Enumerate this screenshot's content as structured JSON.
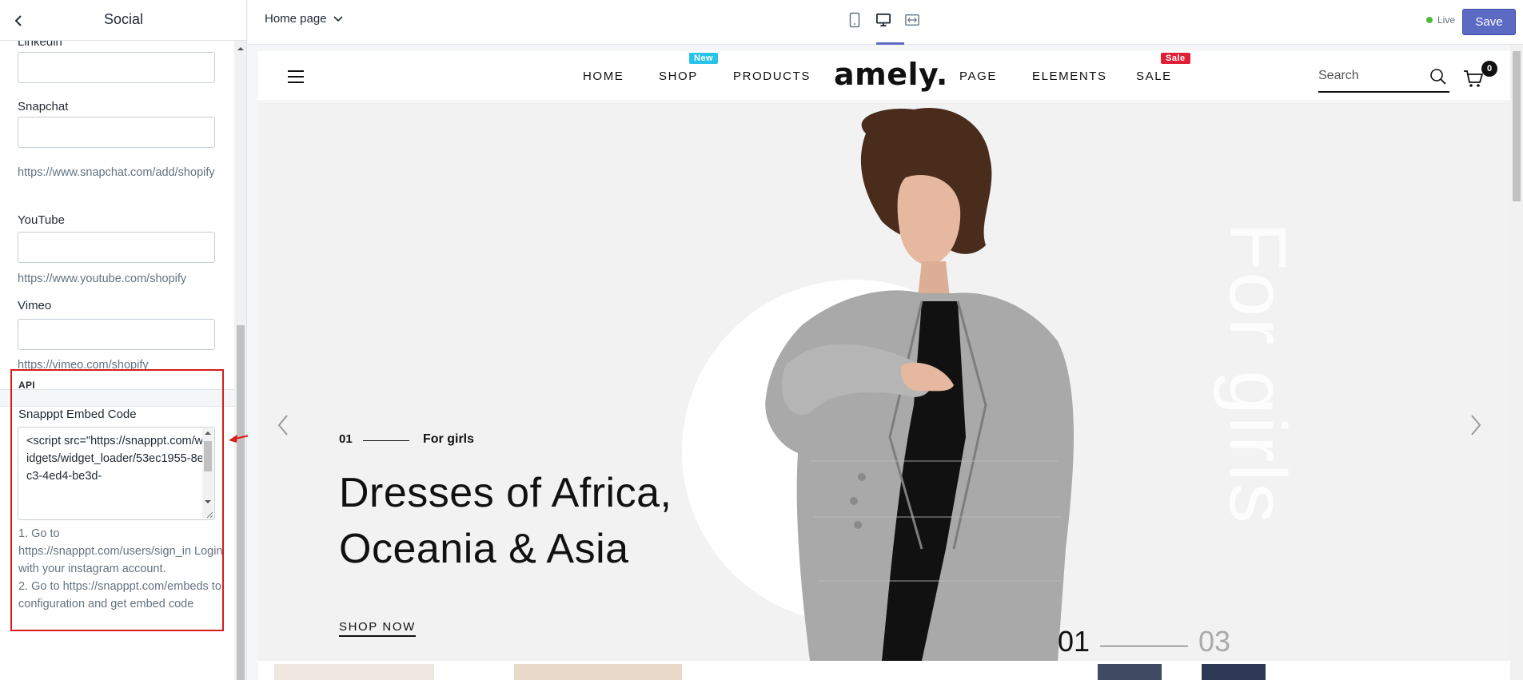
{
  "sidebar": {
    "title": "Social",
    "fields": [
      {
        "label": "Linkedin",
        "value": "",
        "help": ""
      },
      {
        "label": "Snapchat",
        "value": "",
        "help": "https://www.snapchat.com/add/shopify"
      },
      {
        "label": "YouTube",
        "value": "",
        "help": "https://www.youtube.com/shopify"
      },
      {
        "label": "Vimeo",
        "value": "",
        "help": "https://vimeo.com/shopify"
      }
    ],
    "api": {
      "heading": "API",
      "embed_label": "Snapppt Embed Code",
      "embed_value": "<script src=\"https://snapppt.com/widgets/widget_loader/53ec1955-8ec3-4ed4-be3d-",
      "help_lines": [
        "1. Go to https://snapppt.com/users/sign_in Login with your instagram account.",
        "2. Go to https://snapppt.com/embeds to configuration and get embed code"
      ]
    }
  },
  "topbar": {
    "page_selector": "Home page",
    "status": "Live",
    "save_label": "Save",
    "device_icons": [
      "mobile-icon",
      "desktop-icon",
      "fullscreen-icon"
    ]
  },
  "store": {
    "nav": [
      {
        "label": "HOME"
      },
      {
        "label": "SHOP",
        "badge": "New",
        "badge_color": "#27c3e8"
      },
      {
        "label": "PRODUCTS"
      },
      {
        "label": "PAGE"
      },
      {
        "label": "ELEMENTS"
      },
      {
        "label": "SALE",
        "badge": "Sale",
        "badge_color": "#e01f36"
      }
    ],
    "logo": "amely.",
    "search_placeholder": "Search",
    "cart_count": "0",
    "hero": {
      "slide_number": "01",
      "tag": "For girls",
      "title": "Dresses of Africa, Oceania & Asia",
      "cta": "SHOP NOW",
      "vertical_text": "For girls",
      "pager_current": "01",
      "pager_total": "03"
    }
  },
  "colors": {
    "accent": "#5c6ac4",
    "highlight_box": "#d81b1b",
    "live_dot": "#50b83c"
  }
}
